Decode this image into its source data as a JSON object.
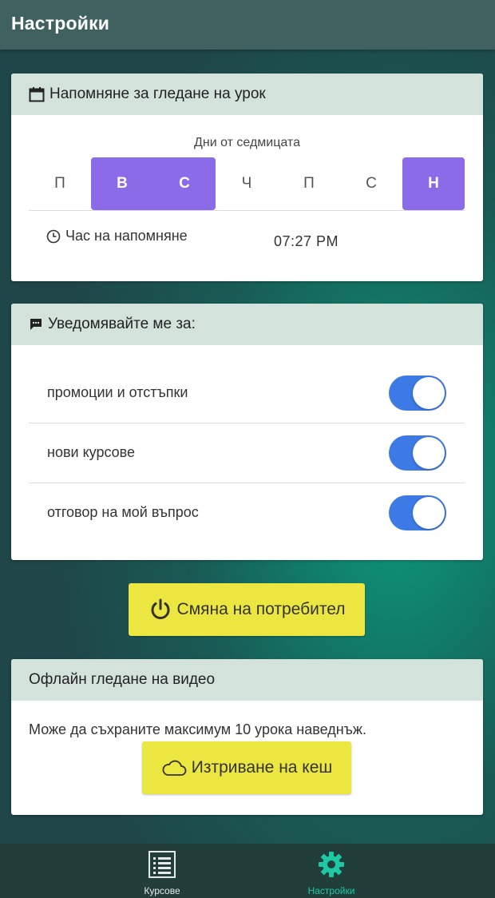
{
  "header": {
    "title": "Настройки"
  },
  "reminder": {
    "title": "Напомняне за гледане на урок",
    "days_label": "Дни от седмицата",
    "days": [
      {
        "label": "П",
        "selected": false
      },
      {
        "label": "В",
        "selected": true
      },
      {
        "label": "С",
        "selected": true
      },
      {
        "label": "Ч",
        "selected": false
      },
      {
        "label": "П",
        "selected": false
      },
      {
        "label": "С",
        "selected": false
      },
      {
        "label": "Н",
        "selected": true
      }
    ],
    "time_label": "Час на напомняне",
    "time_value": "07:27 PM"
  },
  "notify": {
    "title": "Уведомявайте ме за:",
    "items": [
      {
        "label": "промоции и отстъпки",
        "enabled": true
      },
      {
        "label": "нови курсове",
        "enabled": true
      },
      {
        "label": "отговор на мой въпрос",
        "enabled": true
      }
    ]
  },
  "switch_user": {
    "label": "Смяна на потребител"
  },
  "offline": {
    "title": "Офлайн гледане на видео",
    "text": "Може да съхраните максимум 10 урока наведнъж.",
    "clear_cache_label": "Изтриване на кеш"
  },
  "bottom_nav": {
    "courses_label": "Курсове",
    "settings_label": "Настройки",
    "active": "settings"
  },
  "colors": {
    "day_selected": "#8c6be8",
    "toggle_on": "#3d7ae6",
    "button_yellow": "#ece641",
    "nav_active": "#1ec8a4"
  }
}
